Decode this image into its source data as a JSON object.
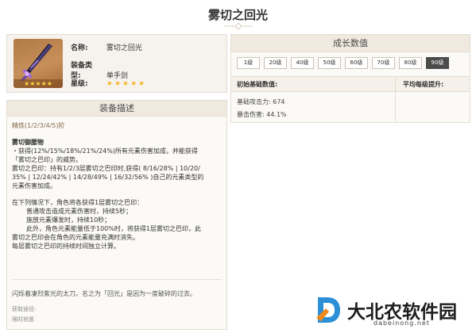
{
  "page": {
    "title": "雾切之回光"
  },
  "info": {
    "name_label": "名称:",
    "name_value": "雾切之回光",
    "type_label": "装备类型:",
    "type_value": "单手剑",
    "rarity_label": "星级:",
    "rarity_stars": "★★★★★",
    "image_stars": "★★★★★"
  },
  "description": {
    "header": "装备描述",
    "refine": "精炼(1/2/3/4/5)阶",
    "lines": [
      "雾切御腰物",
      "・获得(12%/15%/18%/21%/24%)所有元素伤害加成，并能获得",
      "「雾切之巴印」的威势。",
      "雾切之巴印：持有1/2/3层雾切之巴印时,获得( 8/16/28% | 10/20/",
      "35% | 12/24/42% | 14/28/49% | 16/32/56% )自己的元素类型的",
      "元素伤害加成。",
      "在下列情况下，角色将各获得1层雾切之巴印：",
      "普通攻击造成元素伤害时，持续5秒；",
      "施放元素爆发时，持续10秒；",
      "此外，角色元素能量低于100%时，将获得1层雾切之巴印，此",
      "雾切之巴印会在角色的元素能量充满时消失。",
      "每层雾切之巴印的持续时间独立计算。"
    ],
    "flavor": "闪烁着凄烈紫光的太刀。名之为「回光」是因为一度破碎的过去。",
    "source_label": "获取途径:",
    "source_value": "限时祈愿"
  },
  "growth": {
    "header": "成长数值",
    "levels": [
      "1级",
      "20级",
      "40级",
      "50级",
      "60级",
      "70级",
      "80级",
      "90级"
    ],
    "active_level": "90级",
    "base_title": "初始基础数值:",
    "avg_title": "平均每级提升:",
    "stat_atk": "基础攻击力: 674",
    "stat_crit": "暴击伤害: 44.1%"
  },
  "watermark": {
    "text": "大北农软件园",
    "sub": "dabeinong.net"
  },
  "colors": {
    "accent_blue": "#3a86c5",
    "star_gold": "#f3b62a",
    "panel_header": "#efe9df"
  }
}
